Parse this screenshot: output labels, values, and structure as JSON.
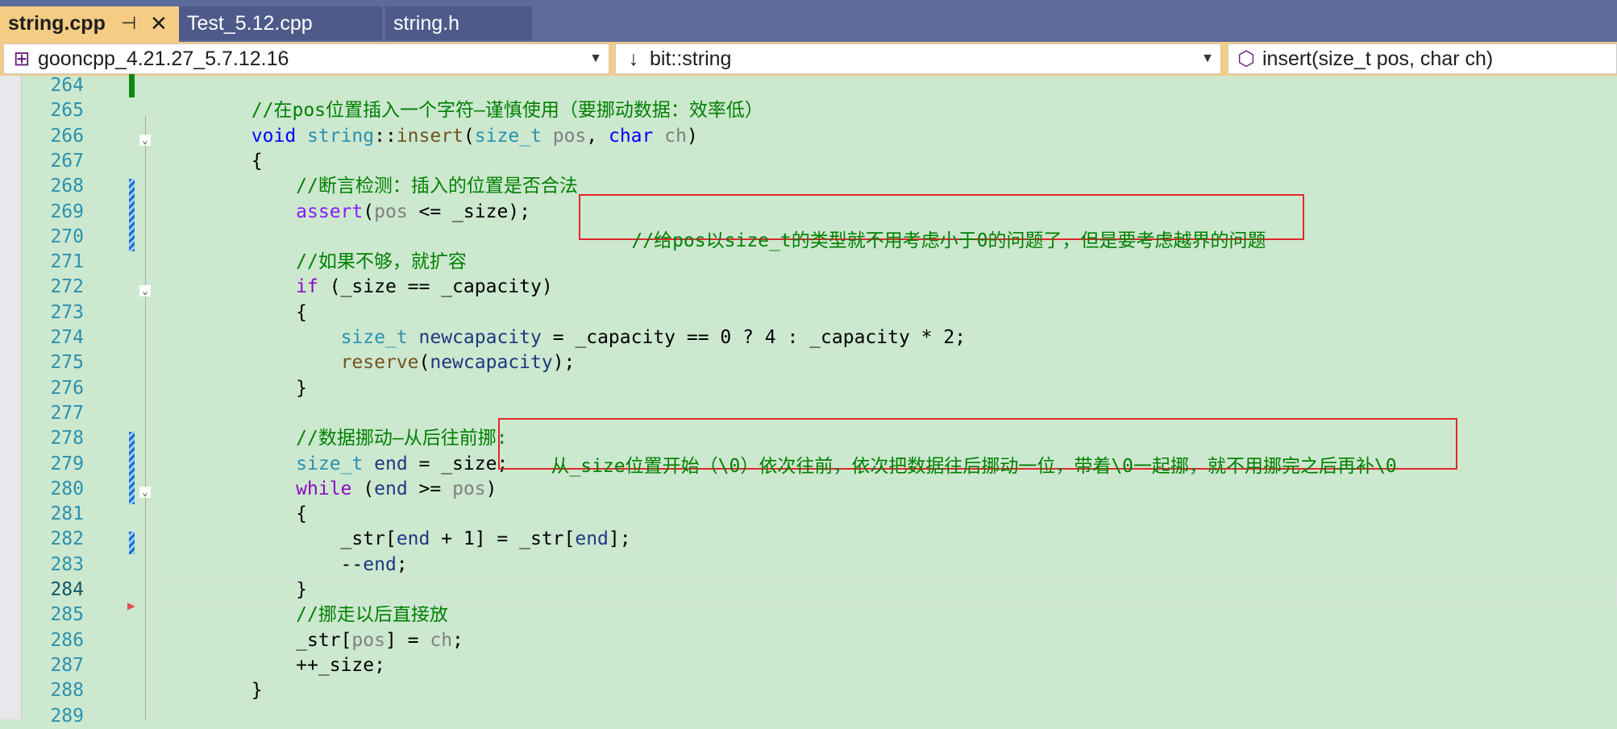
{
  "tabs": [
    {
      "label": "string.cpp",
      "pin": "⊣",
      "close": "✕"
    },
    {
      "label": "Test_5.12.cpp"
    },
    {
      "label": "string.h"
    }
  ],
  "navbar": {
    "project": "gooncpp_4.21.27_5.7.12.16",
    "scope": "bit::string",
    "member": "insert(size_t pos, char ch)",
    "scope_icon": "↓",
    "project_icon": "⊞",
    "member_icon": "⬡",
    "arrow": "▼"
  },
  "editor": {
    "line_numbers": [
      "264",
      "265",
      "266",
      "267",
      "268",
      "269",
      "270",
      "271",
      "272",
      "273",
      "274",
      "275",
      "276",
      "277",
      "278",
      "279",
      "280",
      "281",
      "282",
      "283",
      "284",
      "285",
      "286",
      "287",
      "288",
      "289"
    ],
    "current_line": "284",
    "lines": [
      [],
      [
        {
          "t": "        "
        },
        {
          "t": "//在pos位置插入一个字符—谨慎使用（要挪动数据：效率低）",
          "c": "cm"
        }
      ],
      [
        {
          "t": "        "
        },
        {
          "t": "void",
          "c": "kw"
        },
        {
          "t": " "
        },
        {
          "t": "string",
          "c": "ty"
        },
        {
          "t": "::"
        },
        {
          "t": "insert",
          "c": "fn"
        },
        {
          "t": "("
        },
        {
          "t": "size_t",
          "c": "ty"
        },
        {
          "t": " "
        },
        {
          "t": "pos",
          "c": "par"
        },
        {
          "t": ", "
        },
        {
          "t": "char",
          "c": "kw"
        },
        {
          "t": " "
        },
        {
          "t": "ch",
          "c": "par"
        },
        {
          "t": ")"
        }
      ],
      [
        {
          "t": "        {"
        }
      ],
      [
        {
          "t": "            "
        },
        {
          "t": "//断言检测：插入的位置是否合法",
          "c": "cm"
        }
      ],
      [
        {
          "t": "            "
        },
        {
          "t": "assert",
          "c": "mac"
        },
        {
          "t": "("
        },
        {
          "t": "pos",
          "c": "par"
        },
        {
          "t": " <= _size);"
        }
      ],
      [],
      [
        {
          "t": "            "
        },
        {
          "t": "//如果不够，就扩容",
          "c": "cm"
        }
      ],
      [
        {
          "t": "            "
        },
        {
          "t": "if",
          "c": "ctl"
        },
        {
          "t": " (_size == _capacity)"
        }
      ],
      [
        {
          "t": "            {"
        }
      ],
      [
        {
          "t": "                "
        },
        {
          "t": "size_t",
          "c": "ty"
        },
        {
          "t": " "
        },
        {
          "t": "newcapacity",
          "c": "mem"
        },
        {
          "t": " = _capacity == 0 ? 4 : _capacity * 2;"
        }
      ],
      [
        {
          "t": "                "
        },
        {
          "t": "reserve",
          "c": "fn"
        },
        {
          "t": "("
        },
        {
          "t": "newcapacity",
          "c": "mem"
        },
        {
          "t": ");"
        }
      ],
      [
        {
          "t": "            }"
        }
      ],
      [],
      [
        {
          "t": "            "
        },
        {
          "t": "//数据挪动—从后往前挪:",
          "c": "cm"
        }
      ],
      [
        {
          "t": "            "
        },
        {
          "t": "size_t",
          "c": "ty"
        },
        {
          "t": " "
        },
        {
          "t": "end",
          "c": "mem"
        },
        {
          "t": " = _size;"
        }
      ],
      [
        {
          "t": "            "
        },
        {
          "t": "while",
          "c": "ctl"
        },
        {
          "t": " ("
        },
        {
          "t": "end",
          "c": "mem"
        },
        {
          "t": " >= "
        },
        {
          "t": "pos",
          "c": "par"
        },
        {
          "t": ")"
        }
      ],
      [
        {
          "t": "            {"
        }
      ],
      [
        {
          "t": "                _str["
        },
        {
          "t": "end",
          "c": "mem"
        },
        {
          "t": " + 1] = _str["
        },
        {
          "t": "end",
          "c": "mem"
        },
        {
          "t": "];"
        }
      ],
      [
        {
          "t": "                --"
        },
        {
          "t": "end",
          "c": "mem"
        },
        {
          "t": ";"
        }
      ],
      [
        {
          "t": "            }"
        }
      ],
      [
        {
          "t": "            "
        },
        {
          "t": "//挪走以后直接放",
          "c": "cm"
        }
      ],
      [
        {
          "t": "            _str["
        },
        {
          "t": "pos",
          "c": "par"
        },
        {
          "t": "] = "
        },
        {
          "t": "ch",
          "c": "par"
        },
        {
          "t": ";"
        }
      ],
      [
        {
          "t": "            ++_size;"
        }
      ],
      [
        {
          "t": "        }"
        }
      ],
      []
    ]
  },
  "annotations": [
    {
      "text": "//给pos以size_t的类型就不用考虑小于0的问题了，但是要考虑越界的问题"
    },
    {
      "text": "从_size位置开始（\\0）依次往前，依次把数据往后挪动一位，带着\\0一起挪，就不用挪完之后再补\\0"
    }
  ]
}
